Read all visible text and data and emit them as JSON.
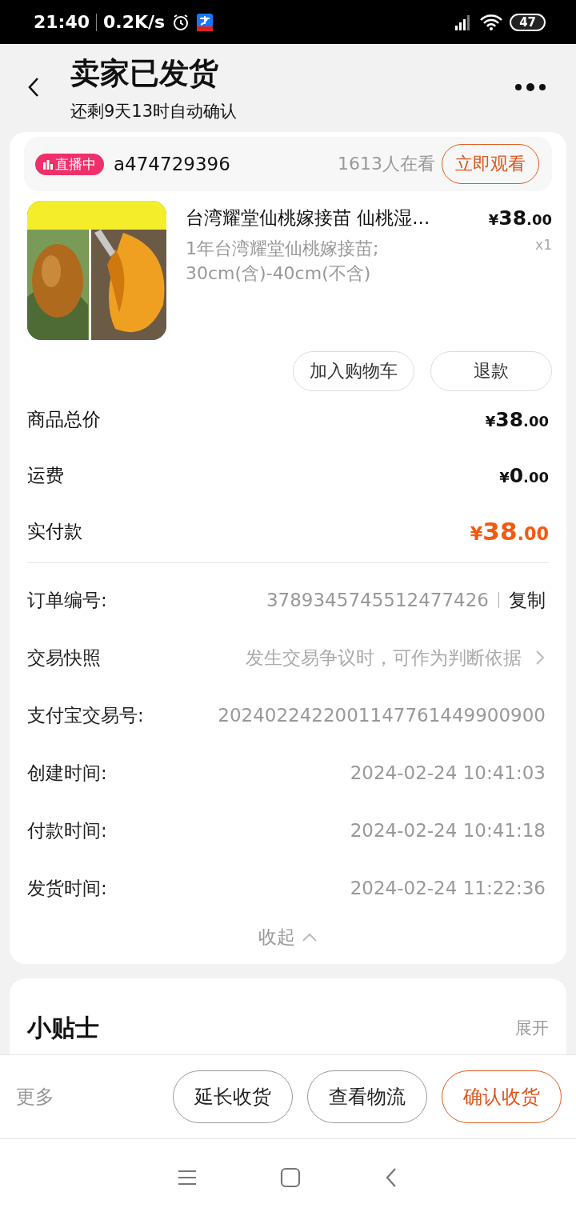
{
  "status_bar": {
    "time": "21:40",
    "speed": "0.2K/s",
    "battery": "47"
  },
  "header": {
    "title": "卖家已发货",
    "subtitle": "还剩9天13时自动确认"
  },
  "live": {
    "badge": "直播中",
    "name": "a474729396",
    "viewers": "1613人在看",
    "button": "立即观看"
  },
  "product": {
    "image": {
      "kind": "picture"
    },
    "title": "台湾耀堂仙桃嫁接苗 仙桃湿...",
    "price": "¥38.00",
    "quantity": "x1",
    "spec": "1年台湾耀堂仙桃嫁接苗;\n30cm(含)-40cm(不含)",
    "buttons": [
      "加入购物车",
      "退款"
    ]
  },
  "totals": [
    {
      "label": "商品总价",
      "value": "¥38.00",
      "kind": "normal"
    },
    {
      "label": "运费",
      "value": "¥0.00",
      "kind": "normal"
    },
    {
      "label": "实付款",
      "value": "¥38.00",
      "kind": "highlight"
    }
  ],
  "details": [
    {
      "label": "订单编号:",
      "value": "3789345745512477426",
      "kind": "copy",
      "action": "复制"
    },
    {
      "label": "交易快照",
      "value": "发生交易争议时，可作为判断依据",
      "kind": "link"
    },
    {
      "label": "支付宝交易号:",
      "value": "2024022422001147761449900900",
      "kind": "plain"
    },
    {
      "label": "创建时间:",
      "value": "2024-02-24 10:41:03",
      "kind": "plain"
    },
    {
      "label": "付款时间:",
      "value": "2024-02-24 10:41:18",
      "kind": "plain"
    },
    {
      "label": "发货时间:",
      "value": "2024-02-24 11:22:36",
      "kind": "plain"
    }
  ],
  "collapse": "收起",
  "tips": {
    "title": "小贴士",
    "toggle": "展开"
  },
  "bottom_bar": {
    "more": "更多",
    "buttons": [
      {
        "label": "延长收货",
        "kind": "normal"
      },
      {
        "label": "查看物流",
        "kind": "normal"
      },
      {
        "label": "确认收货",
        "kind": "primary"
      }
    ]
  }
}
